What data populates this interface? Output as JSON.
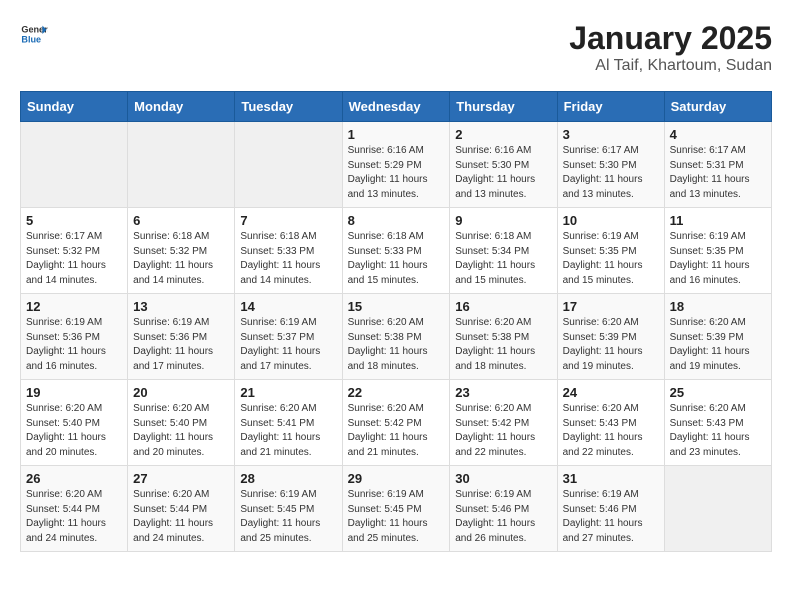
{
  "header": {
    "logo_general": "General",
    "logo_blue": "Blue",
    "title": "January 2025",
    "subtitle": "Al Taif, Khartoum, Sudan"
  },
  "weekdays": [
    "Sunday",
    "Monday",
    "Tuesday",
    "Wednesday",
    "Thursday",
    "Friday",
    "Saturday"
  ],
  "weeks": [
    [
      {
        "day": "",
        "info": ""
      },
      {
        "day": "",
        "info": ""
      },
      {
        "day": "",
        "info": ""
      },
      {
        "day": "1",
        "info": "Sunrise: 6:16 AM\nSunset: 5:29 PM\nDaylight: 11 hours\nand 13 minutes."
      },
      {
        "day": "2",
        "info": "Sunrise: 6:16 AM\nSunset: 5:30 PM\nDaylight: 11 hours\nand 13 minutes."
      },
      {
        "day": "3",
        "info": "Sunrise: 6:17 AM\nSunset: 5:30 PM\nDaylight: 11 hours\nand 13 minutes."
      },
      {
        "day": "4",
        "info": "Sunrise: 6:17 AM\nSunset: 5:31 PM\nDaylight: 11 hours\nand 13 minutes."
      }
    ],
    [
      {
        "day": "5",
        "info": "Sunrise: 6:17 AM\nSunset: 5:32 PM\nDaylight: 11 hours\nand 14 minutes."
      },
      {
        "day": "6",
        "info": "Sunrise: 6:18 AM\nSunset: 5:32 PM\nDaylight: 11 hours\nand 14 minutes."
      },
      {
        "day": "7",
        "info": "Sunrise: 6:18 AM\nSunset: 5:33 PM\nDaylight: 11 hours\nand 14 minutes."
      },
      {
        "day": "8",
        "info": "Sunrise: 6:18 AM\nSunset: 5:33 PM\nDaylight: 11 hours\nand 15 minutes."
      },
      {
        "day": "9",
        "info": "Sunrise: 6:18 AM\nSunset: 5:34 PM\nDaylight: 11 hours\nand 15 minutes."
      },
      {
        "day": "10",
        "info": "Sunrise: 6:19 AM\nSunset: 5:35 PM\nDaylight: 11 hours\nand 15 minutes."
      },
      {
        "day": "11",
        "info": "Sunrise: 6:19 AM\nSunset: 5:35 PM\nDaylight: 11 hours\nand 16 minutes."
      }
    ],
    [
      {
        "day": "12",
        "info": "Sunrise: 6:19 AM\nSunset: 5:36 PM\nDaylight: 11 hours\nand 16 minutes."
      },
      {
        "day": "13",
        "info": "Sunrise: 6:19 AM\nSunset: 5:36 PM\nDaylight: 11 hours\nand 17 minutes."
      },
      {
        "day": "14",
        "info": "Sunrise: 6:19 AM\nSunset: 5:37 PM\nDaylight: 11 hours\nand 17 minutes."
      },
      {
        "day": "15",
        "info": "Sunrise: 6:20 AM\nSunset: 5:38 PM\nDaylight: 11 hours\nand 18 minutes."
      },
      {
        "day": "16",
        "info": "Sunrise: 6:20 AM\nSunset: 5:38 PM\nDaylight: 11 hours\nand 18 minutes."
      },
      {
        "day": "17",
        "info": "Sunrise: 6:20 AM\nSunset: 5:39 PM\nDaylight: 11 hours\nand 19 minutes."
      },
      {
        "day": "18",
        "info": "Sunrise: 6:20 AM\nSunset: 5:39 PM\nDaylight: 11 hours\nand 19 minutes."
      }
    ],
    [
      {
        "day": "19",
        "info": "Sunrise: 6:20 AM\nSunset: 5:40 PM\nDaylight: 11 hours\nand 20 minutes."
      },
      {
        "day": "20",
        "info": "Sunrise: 6:20 AM\nSunset: 5:40 PM\nDaylight: 11 hours\nand 20 minutes."
      },
      {
        "day": "21",
        "info": "Sunrise: 6:20 AM\nSunset: 5:41 PM\nDaylight: 11 hours\nand 21 minutes."
      },
      {
        "day": "22",
        "info": "Sunrise: 6:20 AM\nSunset: 5:42 PM\nDaylight: 11 hours\nand 21 minutes."
      },
      {
        "day": "23",
        "info": "Sunrise: 6:20 AM\nSunset: 5:42 PM\nDaylight: 11 hours\nand 22 minutes."
      },
      {
        "day": "24",
        "info": "Sunrise: 6:20 AM\nSunset: 5:43 PM\nDaylight: 11 hours\nand 22 minutes."
      },
      {
        "day": "25",
        "info": "Sunrise: 6:20 AM\nSunset: 5:43 PM\nDaylight: 11 hours\nand 23 minutes."
      }
    ],
    [
      {
        "day": "26",
        "info": "Sunrise: 6:20 AM\nSunset: 5:44 PM\nDaylight: 11 hours\nand 24 minutes."
      },
      {
        "day": "27",
        "info": "Sunrise: 6:20 AM\nSunset: 5:44 PM\nDaylight: 11 hours\nand 24 minutes."
      },
      {
        "day": "28",
        "info": "Sunrise: 6:19 AM\nSunset: 5:45 PM\nDaylight: 11 hours\nand 25 minutes."
      },
      {
        "day": "29",
        "info": "Sunrise: 6:19 AM\nSunset: 5:45 PM\nDaylight: 11 hours\nand 25 minutes."
      },
      {
        "day": "30",
        "info": "Sunrise: 6:19 AM\nSunset: 5:46 PM\nDaylight: 11 hours\nand 26 minutes."
      },
      {
        "day": "31",
        "info": "Sunrise: 6:19 AM\nSunset: 5:46 PM\nDaylight: 11 hours\nand 27 minutes."
      },
      {
        "day": "",
        "info": ""
      }
    ]
  ]
}
